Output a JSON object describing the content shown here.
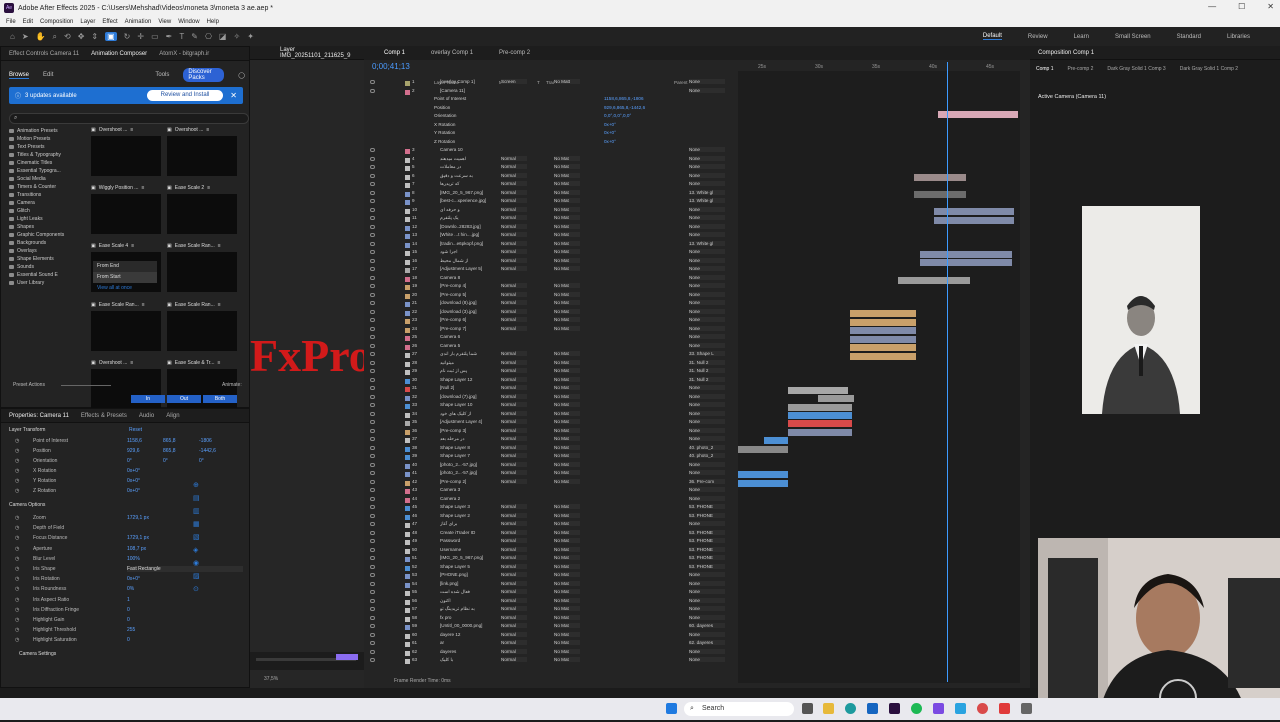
{
  "window": {
    "title": "Adobe After Effects 2025 - C:\\Users\\Mehshad\\Videos\\moneta 3\\moneta 3 ae.aep *",
    "controls": [
      "—",
      "☐",
      "✕"
    ]
  },
  "menu": [
    "File",
    "Edit",
    "Composition",
    "Layer",
    "Effect",
    "Animation",
    "View",
    "Window",
    "Help"
  ],
  "workspaces": {
    "items": [
      "Default",
      "Review",
      "Learn",
      "Small Screen",
      "Standard",
      "Libraries"
    ],
    "active": "Default"
  },
  "left_tabs": [
    "Effect Controls Camera 11",
    "Animation Composer",
    "AtomX - bitgraph.ir"
  ],
  "browser": {
    "tabs": [
      "Browse",
      "Edit"
    ],
    "tools_label": "Tools",
    "discover_label": "Discover Packs",
    "update_text": "3 updates available",
    "review_label": "Review and Install",
    "tree": [
      "Animation Presets",
      "Motion Presets",
      "Text Presets",
      "Titles & Typography",
      "Cinematic Titles",
      "Essential Typogra...",
      "Social Media",
      "Timers & Counter",
      "Transitions",
      "Camera",
      "Glitch",
      "Light Leaks",
      "Shapes",
      "Graphic Components",
      "Backgrounds",
      "Overlays",
      "Shape Elements",
      "Sounds",
      "Essential Sound E",
      "User Library"
    ],
    "presets": [
      {
        "name": "Overshoot ..."
      },
      {
        "name": "Overshoot ..."
      },
      {
        "name": "Wiggly Position ..."
      },
      {
        "name": "Ease Scale 2"
      },
      {
        "name": "Ease Scale 4"
      },
      {
        "name": "Ease Scale Ran..."
      },
      {
        "name": "Ease Scale Ran..."
      },
      {
        "name": "Ease Scale Ran..."
      },
      {
        "name": "Overshoot ..."
      },
      {
        "name": "Ease Scale & Tr..."
      }
    ],
    "from_end": "From End",
    "from_start": "From Start",
    "view_all": "View all at once",
    "preset_actions": "Preset Actions",
    "animate": "Animate:",
    "in_out": [
      "In",
      "Out",
      "Both"
    ]
  },
  "properties": {
    "tabs": [
      "Properties: Camera 11",
      "Effects & Presets",
      "Audio",
      "Align"
    ],
    "layer_transform": "Layer Transform",
    "reset": "Reset",
    "rows": [
      {
        "label": "Point of Interest",
        "vals": [
          "1158,6",
          "865,8",
          "-1806"
        ]
      },
      {
        "label": "Position",
        "vals": [
          "929,6",
          "865,8",
          "-1442,6"
        ]
      },
      {
        "label": "Orientation",
        "vals": [
          "0°",
          "0°",
          "0°"
        ]
      },
      {
        "label": "X Rotation",
        "vals": [
          "0x+0°"
        ]
      },
      {
        "label": "Y Rotation",
        "vals": [
          "0x+0°"
        ]
      },
      {
        "label": "Z Rotation",
        "vals": [
          "0x+0°"
        ]
      }
    ],
    "camera_options": "Camera Options",
    "cam_rows": [
      {
        "label": "Zoom",
        "val": "1729,1 px"
      },
      {
        "label": "Depth of Field",
        "val": ""
      },
      {
        "label": "Focus Distance",
        "val": "1729,1 px"
      },
      {
        "label": "Aperture",
        "val": "108,7 px"
      },
      {
        "label": "Blur Level",
        "val": "100%"
      },
      {
        "label": "Iris Shape",
        "val": "Fast Rectangle"
      },
      {
        "label": "Iris Rotation",
        "val": "0x+0°"
      },
      {
        "label": "Iris Roundness",
        "val": "0%"
      },
      {
        "label": "Iris Aspect Ratio",
        "val": "1"
      },
      {
        "label": "Iris Diffraction Fringe",
        "val": "0"
      },
      {
        "label": "Highlight Gain",
        "val": "0"
      },
      {
        "label": "Highlight Threshold",
        "val": "255"
      },
      {
        "label": "Highlight Saturation",
        "val": "0"
      }
    ],
    "camera_settings": "Camera Settings"
  },
  "layer_panel": {
    "title": "Layer IMG_20251101_211625_9",
    "overlay_text": "FxPro",
    "zoom": "37,5%"
  },
  "timeline": {
    "comp_tabs": [
      "Comp 1",
      "overlay Comp 1",
      "Pre-comp 2"
    ],
    "timecode": "0;00;41;13",
    "headers": [
      "Layer Name",
      "Mode",
      "T",
      "Track Matte",
      "Parent & Link"
    ],
    "ruler": [
      "25s",
      "30s",
      "35s",
      "40s",
      "45s"
    ],
    "footer": "Frame Render Time: 0ms",
    "layers": [
      {
        "n": "1",
        "name": "[overlay Comp 1]",
        "mode": "Screen",
        "mat": "No Matt",
        "par": "None",
        "c": "#a7a36c"
      },
      {
        "n": "2",
        "name": "[Camera 11]",
        "mode": "",
        "mat": "",
        "par": "None",
        "c": "#d36f8d"
      },
      {
        "n": "3",
        "name": "Camera 10",
        "mode": "",
        "mat": "",
        "par": "None",
        "c": "#d36f8d"
      },
      {
        "n": "4",
        "name": "اهمیت میدهند",
        "mode": "Normal",
        "mat": "No Mat",
        "par": "None",
        "c": "#c0c0c0"
      },
      {
        "n": "5",
        "name": "در معاملات",
        "mode": "Normal",
        "mat": "No Mat",
        "par": "None",
        "c": "#c0c0c0"
      },
      {
        "n": "6",
        "name": "به سرعت و دقیق",
        "mode": "Normal",
        "mat": "No Mat",
        "par": "None",
        "c": "#c0c0c0"
      },
      {
        "n": "7",
        "name": "که تریدرها",
        "mode": "Normal",
        "mat": "No Mat",
        "par": "None",
        "c": "#c0c0c0"
      },
      {
        "n": "8",
        "name": "[IMG_20_5_967.png]",
        "mode": "Normal",
        "mat": "No Mat",
        "par": "13. White gl",
        "c": "#7a93c9"
      },
      {
        "n": "9",
        "name": "[best-c...xperience.jpg]",
        "mode": "Normal",
        "mat": "No Mat",
        "par": "13. White gl",
        "c": "#7a93c9"
      },
      {
        "n": "10",
        "name": "و حرفه ای",
        "mode": "Normal",
        "mat": "No Mat",
        "par": "None",
        "c": "#c0c0c0"
      },
      {
        "n": "11",
        "name": "یک پلتفرم",
        "mode": "Normal",
        "mat": "No Mat",
        "par": "None",
        "c": "#c0c0c0"
      },
      {
        "n": "12",
        "name": "[Downlo..28283.jpg]",
        "mode": "Normal",
        "mat": "No Mat",
        "par": "None",
        "c": "#7a93c9"
      },
      {
        "n": "13",
        "name": "[White ...t hin....jpg]",
        "mode": "Normal",
        "mat": "No Mat",
        "par": "None",
        "c": "#7a93c9"
      },
      {
        "n": "14",
        "name": "[tradin...e6pkopf.png]",
        "mode": "Normal",
        "mat": "No Mat",
        "par": "13. White gl",
        "c": "#7a93c9"
      },
      {
        "n": "15",
        "name": "اجرا شود",
        "mode": "Normal",
        "mat": "No Mat",
        "par": "None",
        "c": "#c0c0c0"
      },
      {
        "n": "16",
        "name": "از شمال محیط",
        "mode": "Normal",
        "mat": "No Mat",
        "par": "None",
        "c": "#c0c0c0"
      },
      {
        "n": "17",
        "name": "[Adjustment Layer 5]",
        "mode": "Normal",
        "mat": "No Mat",
        "par": "None",
        "c": "#aaa"
      },
      {
        "n": "18",
        "name": "Camera 8",
        "mode": "",
        "mat": "",
        "par": "None",
        "c": "#d36f8d"
      },
      {
        "n": "19",
        "name": "[Pre-comp 4]",
        "mode": "Normal",
        "mat": "No Mat",
        "par": "None",
        "c": "#c9a06a"
      },
      {
        "n": "20",
        "name": "[Pre-comp 5]",
        "mode": "Normal",
        "mat": "No Mat",
        "par": "None",
        "c": "#c9a06a"
      },
      {
        "n": "21",
        "name": "[download (8).jpg]",
        "mode": "Normal",
        "mat": "No Mat",
        "par": "None",
        "c": "#7a93c9"
      },
      {
        "n": "22",
        "name": "[download (3).jpg]",
        "mode": "Normal",
        "mat": "No Mat",
        "par": "None",
        "c": "#7a93c9"
      },
      {
        "n": "23",
        "name": "[Pre-comp 6]",
        "mode": "Normal",
        "mat": "No Mat",
        "par": "None",
        "c": "#c9a06a"
      },
      {
        "n": "24",
        "name": "[Pre-comp 7]",
        "mode": "Normal",
        "mat": "No Mat",
        "par": "None",
        "c": "#c9a06a"
      },
      {
        "n": "25",
        "name": "Camera 6",
        "mode": "",
        "mat": "",
        "par": "None",
        "c": "#d36f8d"
      },
      {
        "n": "26",
        "name": "Camera 5",
        "mode": "",
        "mat": "",
        "par": "None",
        "c": "#d36f8d"
      },
      {
        "n": "27",
        "name": "شما پلتفرم بار اندی",
        "mode": "Normal",
        "mat": "No Mat",
        "par": "33. Shape L",
        "c": "#c0c0c0"
      },
      {
        "n": "28",
        "name": "میتوانید",
        "mode": "Normal",
        "mat": "No Mat",
        "par": "31. Null 2",
        "c": "#c0c0c0"
      },
      {
        "n": "29",
        "name": "پس از ثبت نام",
        "mode": "Normal",
        "mat": "No Mat",
        "par": "31. Null 2",
        "c": "#c0c0c0"
      },
      {
        "n": "30",
        "name": "Shape Layer 12",
        "mode": "Normal",
        "mat": "No Mat",
        "par": "31. Null 2",
        "c": "#4c8fd4"
      },
      {
        "n": "31",
        "name": "[Null 2]",
        "mode": "Normal",
        "mat": "No Mat",
        "par": "None",
        "c": "#d94a4a"
      },
      {
        "n": "32",
        "name": "[download (7).jpg]",
        "mode": "Normal",
        "mat": "No Mat",
        "par": "None",
        "c": "#7a93c9"
      },
      {
        "n": "33",
        "name": "Shape Layer 10",
        "mode": "Normal",
        "mat": "No Mat",
        "par": "None",
        "c": "#4c8fd4"
      },
      {
        "n": "34",
        "name": "از کلیک های خود",
        "mode": "Normal",
        "mat": "No Mat",
        "par": "None",
        "c": "#c0c0c0"
      },
      {
        "n": "35",
        "name": "[Adjustment Layer 4]",
        "mode": "Normal",
        "mat": "No Mat",
        "par": "None",
        "c": "#aaa"
      },
      {
        "n": "36",
        "name": "[Pre-comp 3]",
        "mode": "Normal",
        "mat": "No Mat",
        "par": "None",
        "c": "#c9a06a"
      },
      {
        "n": "37",
        "name": "در مرحله بعد",
        "mode": "Normal",
        "mat": "No Mat",
        "par": "None",
        "c": "#c0c0c0"
      },
      {
        "n": "38",
        "name": "Shape Layer 8",
        "mode": "Normal",
        "mat": "No Mat",
        "par": "40. photo_2",
        "c": "#4c8fd4"
      },
      {
        "n": "39",
        "name": "Shape Layer 7",
        "mode": "Normal",
        "mat": "No Mat",
        "par": "40. photo_2",
        "c": "#4c8fd4"
      },
      {
        "n": "40",
        "name": "[photo_2...-57.jpg]",
        "mode": "Normal",
        "mat": "No Mat",
        "par": "None",
        "c": "#7a93c9"
      },
      {
        "n": "41",
        "name": "[photo_2...-57.jpg]",
        "mode": "Normal",
        "mat": "No Mat",
        "par": "None",
        "c": "#7a93c9"
      },
      {
        "n": "42",
        "name": "[Pre-comp 2]",
        "mode": "Normal",
        "mat": "No Mat",
        "par": "36. Pre-com",
        "c": "#c9a06a"
      },
      {
        "n": "43",
        "name": "Camera 3",
        "mode": "",
        "mat": "",
        "par": "None",
        "c": "#d36f8d"
      },
      {
        "n": "44",
        "name": "Camera 2",
        "mode": "",
        "mat": "",
        "par": "None",
        "c": "#d36f8d"
      },
      {
        "n": "45",
        "name": "Shape Layer 3",
        "mode": "Normal",
        "mat": "No Mat",
        "par": "53. PHONE",
        "c": "#4c8fd4"
      },
      {
        "n": "46",
        "name": "Shape Layer 2",
        "mode": "Normal",
        "mat": "No Mat",
        "par": "53. PHONE",
        "c": "#4c8fd4"
      },
      {
        "n": "47",
        "name": "برای آغاز",
        "mode": "Normal",
        "mat": "No Mat",
        "par": "None",
        "c": "#c0c0c0"
      },
      {
        "n": "48",
        "name": "Create iTrader ID",
        "mode": "Normal",
        "mat": "No Mat",
        "par": "53. PHONE",
        "c": "#c0c0c0"
      },
      {
        "n": "49",
        "name": "Password",
        "mode": "Normal",
        "mat": "No Mat",
        "par": "53. PHONE",
        "c": "#c0c0c0"
      },
      {
        "n": "50",
        "name": "Username",
        "mode": "Normal",
        "mat": "No Mat",
        "par": "53. PHONE",
        "c": "#c0c0c0"
      },
      {
        "n": "51",
        "name": "[IMG_20_5_967.png]",
        "mode": "Normal",
        "mat": "No Mat",
        "par": "53. PHONE",
        "c": "#7a93c9"
      },
      {
        "n": "52",
        "name": "Shape Layer 5",
        "mode": "Normal",
        "mat": "No Mat",
        "par": "53. PHONE",
        "c": "#4c8fd4"
      },
      {
        "n": "53",
        "name": "[PHONE.png]",
        "mode": "Normal",
        "mat": "No Mat",
        "par": "None",
        "c": "#7a93c9"
      },
      {
        "n": "54",
        "name": "[link.png]",
        "mode": "Normal",
        "mat": "No Mat",
        "par": "None",
        "c": "#7a93c9"
      },
      {
        "n": "55",
        "name": "فعال شده است",
        "mode": "Normal",
        "mat": "No Mat",
        "par": "None",
        "c": "#c0c0c0"
      },
      {
        "n": "56",
        "name": "اکنون",
        "mode": "Normal",
        "mat": "No Mat",
        "par": "None",
        "c": "#c0c0c0"
      },
      {
        "n": "57",
        "name": "به نظام تریدینگ تو",
        "mode": "Normal",
        "mat": "No Mat",
        "par": "None",
        "c": "#c0c0c0"
      },
      {
        "n": "58",
        "name": "fx pro",
        "mode": "Normal",
        "mat": "No Mat",
        "par": "None",
        "c": "#c0c0c0"
      },
      {
        "n": "59",
        "name": "[Untitl_00_0000.png]",
        "mode": "Normal",
        "mat": "No Mat",
        "par": "60. dayeres",
        "c": "#7a93c9"
      },
      {
        "n": "60",
        "name": "dayere 12",
        "mode": "Normal",
        "mat": "No Mat",
        "par": "None",
        "c": "#c0c0c0"
      },
      {
        "n": "61",
        "name": "ar",
        "mode": "Normal",
        "mat": "No Mat",
        "par": "62. dayeres",
        "c": "#c0c0c0"
      },
      {
        "n": "62",
        "name": "dayeres",
        "mode": "Normal",
        "mat": "No Mat",
        "par": "None",
        "c": "#c0c0c0"
      },
      {
        "n": "63",
        "name": "با کلیک",
        "mode": "Normal",
        "mat": "No Mat",
        "par": "None",
        "c": "#c0c0c0"
      }
    ],
    "cam_props": [
      {
        "label": "Point of Interest",
        "val": "1158,6,865,8,-1806"
      },
      {
        "label": "Position",
        "val": "929,6,865,8,-1442,6"
      },
      {
        "label": "Orientation",
        "val": "0,0°,0,0°,0,0°"
      },
      {
        "label": "X Rotation",
        "val": "0x+0°"
      },
      {
        "label": "Y Rotation",
        "val": "0x+0°"
      },
      {
        "label": "Z Rotation",
        "val": "0x+0°"
      }
    ]
  },
  "viewer": {
    "tabs": [
      "Comp 1",
      "Pre-comp 2",
      "Dark Gray Solid 1 Comp 3",
      "Dark Gray Solid 1 Comp 2"
    ],
    "tab_title": "Composition Comp 1",
    "active_camera": "Active Camera (Camera 11)"
  },
  "taskbar": {
    "search": "Search"
  }
}
